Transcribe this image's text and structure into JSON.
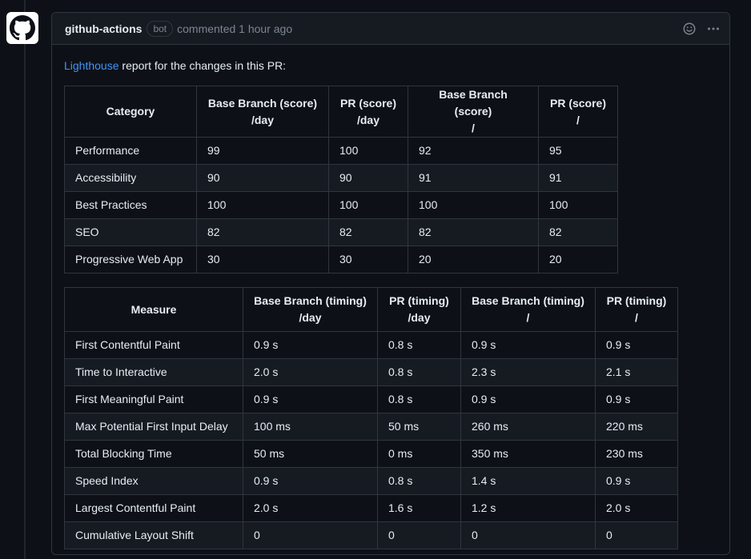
{
  "header": {
    "author": "github-actions",
    "badge": "bot",
    "meta": "commented 1 hour ago"
  },
  "intro": {
    "link": "Lighthouse",
    "text": " report for the changes in this PR:"
  },
  "score_table": {
    "headers": [
      [
        "Category",
        ""
      ],
      [
        "Base Branch (score)",
        "/day"
      ],
      [
        "PR (score)",
        "/day"
      ],
      [
        "Base Branch (score)",
        "/"
      ],
      [
        "PR (score)",
        "/"
      ]
    ],
    "rows": [
      [
        "Performance",
        "99",
        "100",
        "92",
        "95"
      ],
      [
        "Accessibility",
        "90",
        "90",
        "91",
        "91"
      ],
      [
        "Best Practices",
        "100",
        "100",
        "100",
        "100"
      ],
      [
        "SEO",
        "82",
        "82",
        "82",
        "82"
      ],
      [
        "Progressive Web App",
        "30",
        "30",
        "20",
        "20"
      ]
    ]
  },
  "timing_table": {
    "headers": [
      [
        "Measure",
        ""
      ],
      [
        "Base Branch (timing)",
        "/day"
      ],
      [
        "PR (timing)",
        "/day"
      ],
      [
        "Base Branch (timing)",
        "/"
      ],
      [
        "PR (timing)",
        "/"
      ]
    ],
    "rows": [
      [
        "First Contentful Paint",
        "0.9 s",
        "0.8 s",
        "0.9 s",
        "0.9 s"
      ],
      [
        "Time to Interactive",
        "2.0 s",
        "0.8 s",
        "2.3 s",
        "2.1 s"
      ],
      [
        "First Meaningful Paint",
        "0.9 s",
        "0.8 s",
        "0.9 s",
        "0.9 s"
      ],
      [
        "Max Potential First Input Delay",
        "100 ms",
        "50 ms",
        "260 ms",
        "220 ms"
      ],
      [
        "Total Blocking Time",
        "50 ms",
        "0 ms",
        "350 ms",
        "230 ms"
      ],
      [
        "Speed Index",
        "0.9 s",
        "0.8 s",
        "1.4 s",
        "0.9 s"
      ],
      [
        "Largest Contentful Paint",
        "2.0 s",
        "1.6 s",
        "1.2 s",
        "2.0 s"
      ],
      [
        "Cumulative Layout Shift",
        "0",
        "0",
        "0",
        "0"
      ]
    ]
  },
  "icons": {
    "avatar": "github-octocat-icon",
    "reaction": "smiley-icon",
    "menu": "kebab-horizontal-icon"
  },
  "colors": {
    "background": "#0d1117",
    "header_bg": "#161b22",
    "border": "#30363d",
    "link": "#4493f8",
    "muted": "#7d8590",
    "text": "#e6edf3"
  }
}
